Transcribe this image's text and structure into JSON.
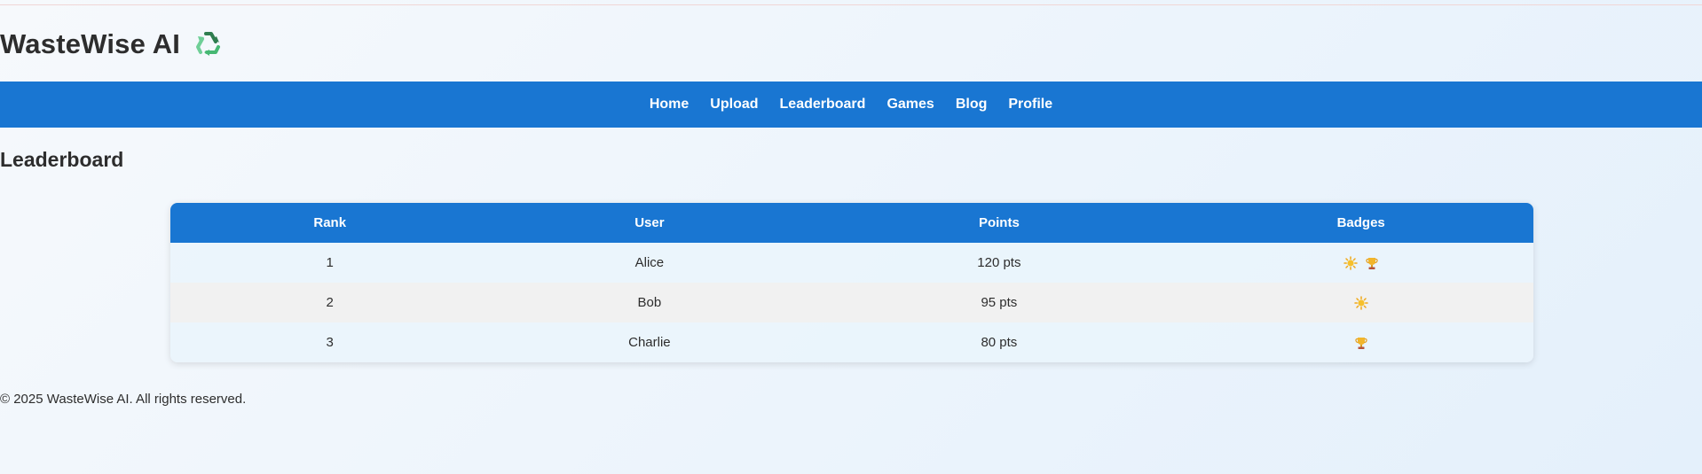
{
  "header": {
    "title": "WasteWise AI",
    "logo_icon": "recycle-icon"
  },
  "nav": {
    "items": [
      {
        "label": "Home"
      },
      {
        "label": "Upload"
      },
      {
        "label": "Leaderboard"
      },
      {
        "label": "Games"
      },
      {
        "label": "Blog"
      },
      {
        "label": "Profile"
      }
    ]
  },
  "page": {
    "title": "Leaderboard"
  },
  "leaderboard": {
    "columns": [
      "Rank",
      "User",
      "Points",
      "Badges"
    ],
    "rows": [
      {
        "rank": "1",
        "user": "Alice",
        "points": "120 pts",
        "badges": [
          "sun-badge-icon",
          "trophy-badge-icon"
        ]
      },
      {
        "rank": "2",
        "user": "Bob",
        "points": "95 pts",
        "badges": [
          "sun-badge-icon"
        ]
      },
      {
        "rank": "3",
        "user": "Charlie",
        "points": "80 pts",
        "badges": [
          "trophy-badge-icon"
        ]
      }
    ]
  },
  "footer": {
    "text": "© 2025 WasteWise AI. All rights reserved."
  },
  "colors": {
    "primary": "#1976d2",
    "logo_green": "#3fae6a"
  }
}
